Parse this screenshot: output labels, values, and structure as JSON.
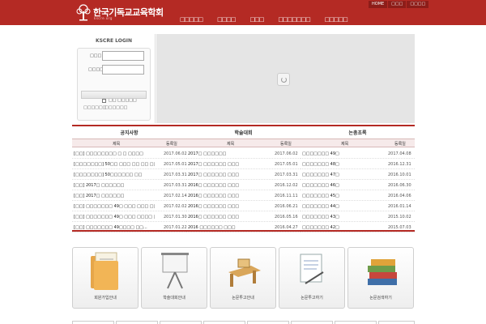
{
  "header": {
    "title": "한국기독교교육학회",
    "subtitle": "kscre.org",
    "top_menu": [
      "HOME",
      "□□□",
      "□□□□"
    ],
    "gnb": [
      "□□□□□",
      "□□□□",
      "□□□",
      "□□□□□□□",
      "□□□□□"
    ],
    "colors": {
      "brand": "#b42a24"
    }
  },
  "login": {
    "title": "KSCRE LOGIN",
    "id_label": "□□□",
    "pw_label": "□□□□",
    "remember_label": "□□ □□□□□",
    "join_link": "□□□□□□",
    "find_link": "□□□□□□"
  },
  "boards": [
    {
      "title": "공지사항",
      "col_title": "제목",
      "col_date": "등록일",
      "rows": [
        {
          "title": "[□□] □□□□□□□□ □ □ □□□□",
          "date": "2017.06.02"
        },
        {
          "title": "[□□□□□□□] 50□□ □□□ □□ □□ □□",
          "date": "2017.05.01"
        },
        {
          "title": "[□□□□□□□] 50□□□□□□ □□",
          "date": "2017.03.31"
        },
        {
          "title": "[□□] 2017□ □□□□□□",
          "date": "2017.03.31"
        },
        {
          "title": "[□□] 2017□ □□□□□□",
          "date": "2017.02.14"
        },
        {
          "title": "[□□] □□□□□□□ 49□ □□□ □□□ □□",
          "date": "2017.02.02"
        },
        {
          "title": "[□□] □□□□□□□ 49□ □□□ □□□□ □□",
          "date": "2017.01.30"
        },
        {
          "title": "[□□] □□□□□□□ 49□□□□ □□...",
          "date": "2017.01.22"
        }
      ]
    },
    {
      "title": "학술대회",
      "col_title": "제목",
      "col_date": "등록일",
      "rows": [
        {
          "title": "2017□ □□□□□□",
          "date": "2017.06.02"
        },
        {
          "title": "2017□ □□□□□□ □□□",
          "date": "2017.05.01"
        },
        {
          "title": "2017□ □□□□□□ □□□",
          "date": "2017.03.31"
        },
        {
          "title": "2016□ □□□□□□ □□□",
          "date": "2016.12.02"
        },
        {
          "title": "2016□ □□□□□□ □□□",
          "date": "2016.11.11"
        },
        {
          "title": "2016□ □□□□□□ □□□",
          "date": "2016.06.21"
        },
        {
          "title": "2016□ □□□□□□ □□□",
          "date": "2016.05.16"
        },
        {
          "title": "2016 □□□□□□ □□□",
          "date": "2016.04.27"
        }
      ]
    },
    {
      "title": "논총초록",
      "col_title": "제목",
      "col_date": "등록일",
      "rows": [
        {
          "title": "□□□□□□□ 49□",
          "date": "2017.04.08"
        },
        {
          "title": "□□□□□□□ 48□",
          "date": "2016.12.31"
        },
        {
          "title": "□□□□□□□ 47□",
          "date": "2016.10.01"
        },
        {
          "title": "□□□□□□□ 46□",
          "date": "2016.06.30"
        },
        {
          "title": "□□□□□□□ 45□",
          "date": "2016.04.06"
        },
        {
          "title": "□□□□□□□ 44□",
          "date": "2016.01.14"
        },
        {
          "title": "□□□□□□□ 43□",
          "date": "2015.10.02"
        },
        {
          "title": "□□□□□□□ 42□",
          "date": "2015.07.03"
        }
      ]
    }
  ],
  "tiles": [
    {
      "label": "회원가입안내",
      "icon": "folder-documents-icon"
    },
    {
      "label": "학술대회안내",
      "icon": "presentation-easel-icon"
    },
    {
      "label": "논문투고안내",
      "icon": "desk-icon"
    },
    {
      "label": "논문투고하기",
      "icon": "document-pen-icon"
    },
    {
      "label": "논문검색하기",
      "icon": "books-icon"
    }
  ]
}
